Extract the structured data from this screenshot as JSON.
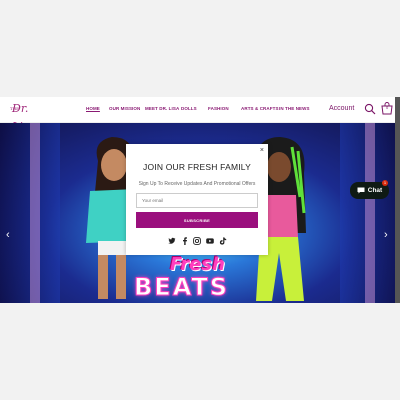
{
  "brand": {
    "logo_small": "THE",
    "logo_text": "Dr. Lisa"
  },
  "nav": {
    "items": [
      {
        "label": "HOME",
        "active": true
      },
      {
        "label": "OUR MISSION",
        "active": false
      },
      {
        "label": "MEET DR. LISA",
        "active": false
      },
      {
        "label": "DOLLS",
        "active": false
      },
      {
        "label": "FASHION",
        "active": false
      },
      {
        "label": "ARTS & CRAFTS",
        "active": false
      },
      {
        "label": "IN THE NEWS",
        "active": false
      }
    ],
    "account_label": "Account",
    "cart_count": "0"
  },
  "hero": {
    "title_line1": "Fresh",
    "title_line2": "BEATS",
    "prev_arrow": "‹",
    "next_arrow": "›"
  },
  "popup": {
    "close": "×",
    "title": "JOIN OUR FRESH FAMILY",
    "subtitle": "Sign Up To Receive Updates And Promotional Offers",
    "email_placeholder": "Your email",
    "subscribe_label": "SUBSCRIBE",
    "socials": [
      "twitter-icon",
      "facebook-icon",
      "instagram-icon",
      "youtube-icon",
      "tiktok-icon"
    ]
  },
  "chat": {
    "label": "Chat",
    "badge": "1"
  },
  "colors": {
    "brand": "#9a0f7d",
    "nav_text": "#8a1a73",
    "chat_bg": "#0f1a14"
  }
}
